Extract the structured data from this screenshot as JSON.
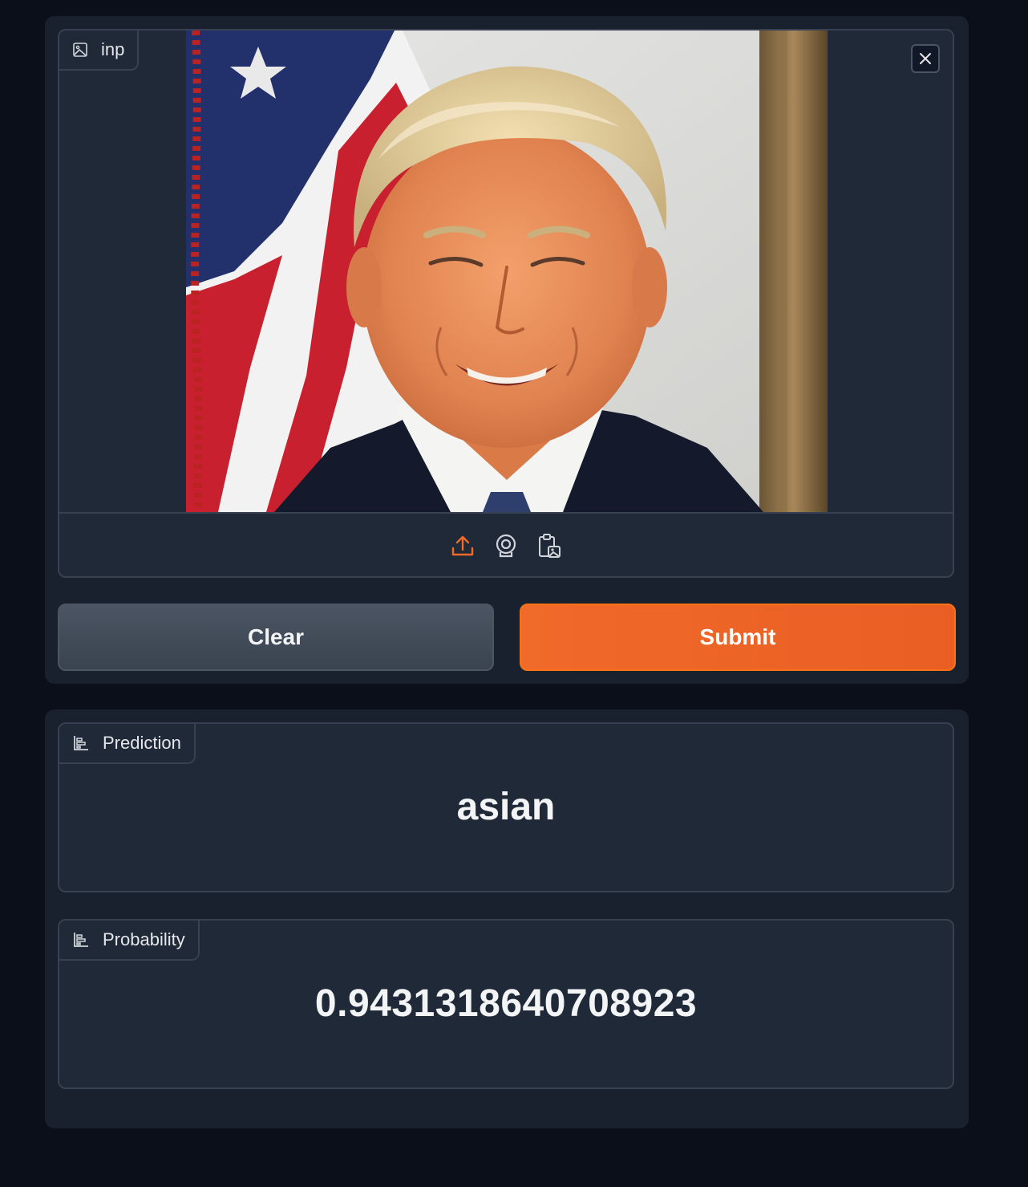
{
  "input": {
    "label": "inp",
    "image_alt": "Portrait photo of a smiling man in a dark suit in front of an American flag",
    "close_title": "Remove image",
    "sources": [
      "upload",
      "webcam",
      "clipboard"
    ]
  },
  "actions": {
    "clear_label": "Clear",
    "submit_label": "Submit"
  },
  "outputs": {
    "prediction_label": "Prediction",
    "prediction_value": "asian",
    "probability_label": "Probability",
    "probability_value": "0.9431318640708923"
  },
  "colors": {
    "background": "#0b0f19",
    "panel": "#1a212e",
    "block": "#1f2937",
    "border": "#374151",
    "accent": "#f06a2a"
  }
}
